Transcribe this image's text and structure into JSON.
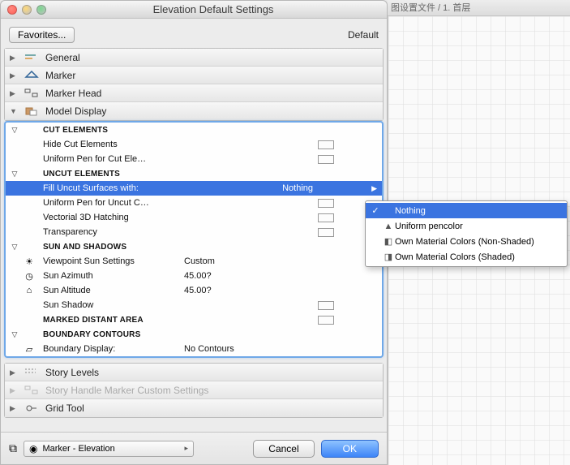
{
  "window": {
    "title": "Elevation Default Settings"
  },
  "topbar": {
    "favorites": "Favorites...",
    "default": "Default"
  },
  "accordion_top": [
    {
      "label": "General"
    },
    {
      "label": "Marker"
    },
    {
      "label": "Marker Head"
    },
    {
      "label": "Model Display"
    }
  ],
  "panel": {
    "groups": {
      "cut": "CUT ELEMENTS",
      "uncut": "UNCUT ELEMENTS",
      "sun": "SUN AND SHADOWS",
      "marked": "MARKED DISTANT AREA",
      "boundary": "BOUNDARY CONTOURS"
    },
    "rows": {
      "hide_cut": "Hide Cut Elements",
      "uni_cut": "Uniform Pen for Cut Ele…",
      "fill_uncut": "Fill Uncut Surfaces with:",
      "fill_uncut_val": "Nothing",
      "uni_uncut": "Uniform Pen for Uncut C…",
      "vec_hatch": "Vectorial 3D Hatching",
      "transp": "Transparency",
      "vps": "Viewpoint Sun Settings",
      "vps_val": "Custom",
      "azim": "Sun Azimuth",
      "azim_val": "45.00?",
      "alt": "Sun Altitude",
      "alt_val": "45.00?",
      "shadow": "Sun Shadow",
      "bdisp": "Boundary Display:",
      "bdisp_val": "No Contours"
    }
  },
  "accordion_bottom": [
    {
      "label": "Story Levels",
      "enabled": true
    },
    {
      "label": "Story Handle Marker Custom Settings",
      "enabled": false
    },
    {
      "label": "Grid Tool",
      "enabled": true
    }
  ],
  "bottombar": {
    "layer": "Marker - Elevation",
    "cancel": "Cancel",
    "ok": "OK"
  },
  "popup": {
    "items": [
      {
        "label": "Nothing",
        "selected": true
      },
      {
        "label": "Uniform pencolor"
      },
      {
        "label": "Own Material Colors (Non-Shaded)"
      },
      {
        "label": "Own Material Colors (Shaded)"
      }
    ]
  },
  "bg": {
    "breadcrumb": "图设置文件 / 1. 首层"
  },
  "chart_data": {
    "type": "table",
    "title": "Model Display parameters",
    "rows": [
      {
        "name": "Hide Cut Elements",
        "value": ""
      },
      {
        "name": "Uniform Pen for Cut Ele…",
        "value": ""
      },
      {
        "name": "Fill Uncut Surfaces with:",
        "value": "Nothing"
      },
      {
        "name": "Uniform Pen for Uncut C…",
        "value": ""
      },
      {
        "name": "Vectorial 3D Hatching",
        "value": ""
      },
      {
        "name": "Transparency",
        "value": ""
      },
      {
        "name": "Viewpoint Sun Settings",
        "value": "Custom"
      },
      {
        "name": "Sun Azimuth",
        "value": "45.00?"
      },
      {
        "name": "Sun Altitude",
        "value": "45.00?"
      },
      {
        "name": "Sun Shadow",
        "value": ""
      },
      {
        "name": "Boundary Display:",
        "value": "No Contours"
      }
    ]
  }
}
